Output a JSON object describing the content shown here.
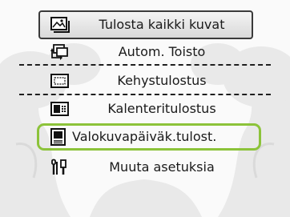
{
  "menu": {
    "items": [
      {
        "label": "Tulosta kaikki kuvat",
        "icon": "print-all-images-icon",
        "selected": false
      },
      {
        "label": "Autom. Toisto",
        "icon": "auto-play-icon",
        "selected": false
      },
      {
        "label": "Kehystulostus",
        "icon": "frame-print-icon",
        "selected": false
      },
      {
        "label": "Kalenteritulostus",
        "icon": "calendar-print-icon",
        "selected": false
      },
      {
        "label": "Valokuvapäiväk.tulost.",
        "icon": "photo-diary-print-icon",
        "selected": true
      },
      {
        "label": "Muuta asetuksia",
        "icon": "settings-icon",
        "selected": false
      }
    ]
  },
  "colors": {
    "selection_frame": "#8cc33a",
    "text": "#1a1a1a",
    "background_art": "#e8e8e8"
  }
}
